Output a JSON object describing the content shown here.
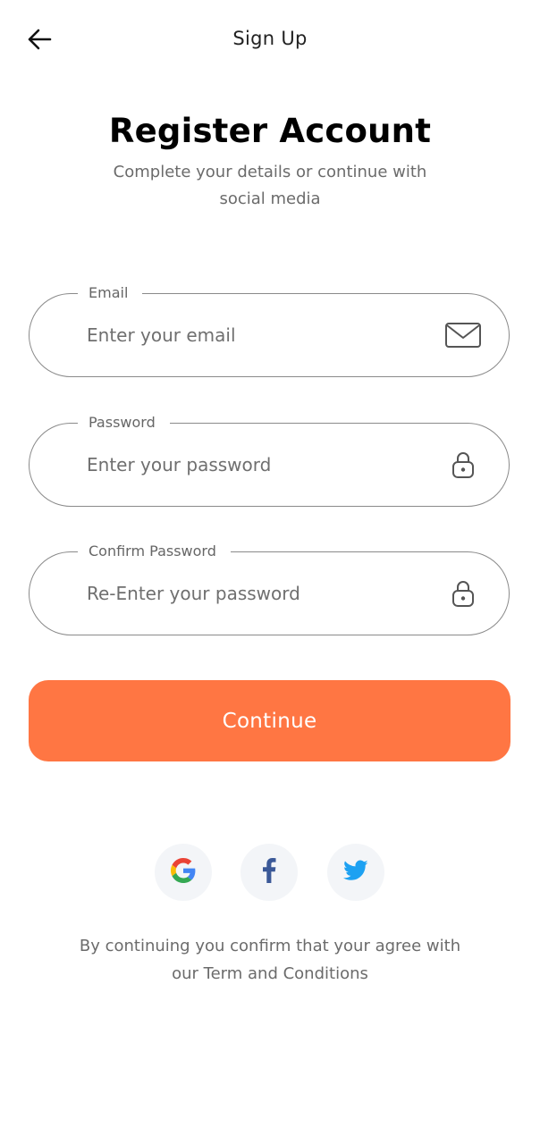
{
  "app_bar": {
    "title": "Sign Up"
  },
  "header": {
    "heading": "Register Account",
    "subheading": "Complete your details or continue with social media"
  },
  "form": {
    "email": {
      "label": "Email",
      "placeholder": "Enter your email",
      "value": "",
      "icon": "mail-icon"
    },
    "password": {
      "label": "Password",
      "placeholder": "Enter your password",
      "value": "",
      "icon": "lock-icon"
    },
    "confirm_password": {
      "label": "Confirm Password",
      "placeholder": "Re-Enter your password",
      "value": "",
      "icon": "lock-icon"
    },
    "continue_label": "Continue"
  },
  "social": {
    "providers": [
      {
        "name": "google",
        "icon": "google-icon"
      },
      {
        "name": "facebook",
        "icon": "facebook-icon"
      },
      {
        "name": "twitter",
        "icon": "twitter-icon"
      }
    ]
  },
  "footer": {
    "terms": "By continuing you confirm that your agree with our Term and Conditions"
  },
  "colors": {
    "accent": "#ff7643",
    "field_border": "#8a8a8a",
    "muted_text": "#6b6b6b",
    "social_bg": "#f3f5f8",
    "facebook": "#3b5998",
    "twitter": "#1da1f2"
  }
}
